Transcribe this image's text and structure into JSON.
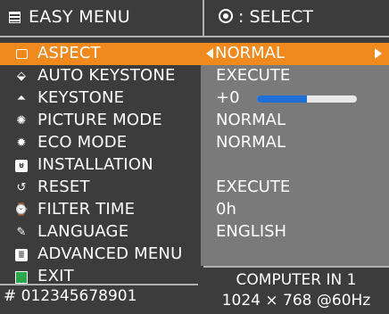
{
  "header": {
    "title": "EASY MENU",
    "select_label": ": SELECT",
    "menu_icon": "list-icon",
    "select_icon": "dpad-icon"
  },
  "menu": {
    "items": [
      {
        "label": "ASPECT",
        "value": "NORMAL",
        "icon": "aspect-icon"
      },
      {
        "label": "AUTO KEYSTONE",
        "value": "EXECUTE",
        "icon": "auto-keystone-icon"
      },
      {
        "label": "KEYSTONE",
        "value": "+0",
        "icon": "keystone-icon"
      },
      {
        "label": "PICTURE MODE",
        "value": "NORMAL",
        "icon": "picture-mode-icon"
      },
      {
        "label": "ECO MODE",
        "value": "NORMAL",
        "icon": "eco-mode-icon"
      },
      {
        "label": "INSTALLATION",
        "value": "",
        "icon": "installation-icon"
      },
      {
        "label": "RESET",
        "value": "EXECUTE",
        "icon": "reset-icon"
      },
      {
        "label": "FILTER TIME",
        "value": "0h",
        "icon": "filter-time-icon"
      },
      {
        "label": "LANGUAGE",
        "value": "ENGLISH",
        "icon": "language-icon"
      },
      {
        "label": "ADVANCED MENU",
        "value": "",
        "icon": "advanced-menu-icon"
      },
      {
        "label": "EXIT",
        "value": "",
        "icon": "exit-icon"
      }
    ]
  },
  "keystone_slider": {
    "level": 0.5
  },
  "footer": {
    "serial": "# 012345678901",
    "input_source": "COMPUTER IN 1",
    "signal": "1024 × 768 @60Hz"
  },
  "colors": {
    "background": "#3c3c3c",
    "value_pane": "#7a7a7a",
    "highlight": "#f08a1e",
    "slider_fill": "#1f6fd6"
  }
}
